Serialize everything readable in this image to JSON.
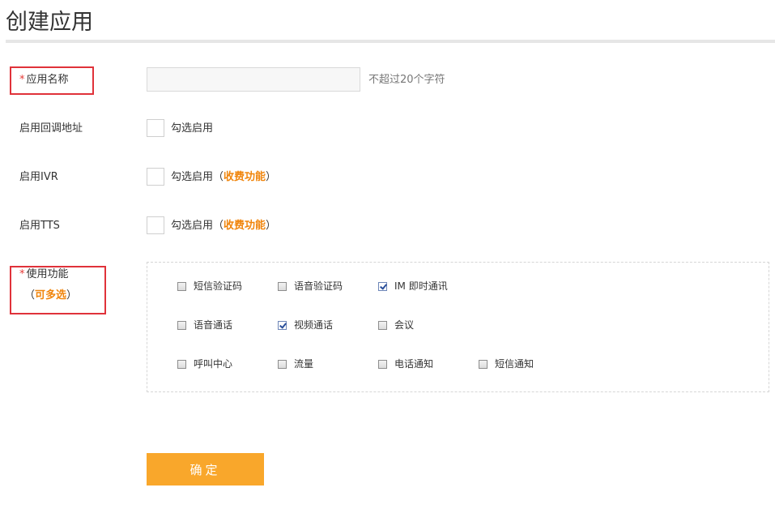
{
  "page": {
    "title": "创建应用"
  },
  "form": {
    "app_name": {
      "required_mark": "*",
      "label": "应用名称",
      "value": "",
      "placeholder": "",
      "hint": "不超过20个字符"
    },
    "callback": {
      "label": "启用回调地址",
      "checkbox_label": "勾选启用",
      "checked": false
    },
    "ivr": {
      "label": "启用IVR",
      "checkbox_label": "勾选启用（",
      "paid_text": "收费功能",
      "close": "）",
      "checked": false
    },
    "tts": {
      "label": "启用TTS",
      "checkbox_label": "勾选启用（",
      "paid_text": "收费功能",
      "close": "）",
      "checked": false
    },
    "features": {
      "required_mark": "*",
      "label": "使用功能",
      "sub_open": "（",
      "sub_text": "可多选",
      "sub_close": "）",
      "options": [
        {
          "label": "短信验证码",
          "checked": false
        },
        {
          "label": "语音验证码",
          "checked": false
        },
        {
          "label": "IM 即时通讯",
          "checked": true
        },
        {
          "label": "语音通话",
          "checked": false
        },
        {
          "label": "视频通话",
          "checked": true
        },
        {
          "label": "会议",
          "checked": false
        },
        {
          "label": "呼叫中心",
          "checked": false
        },
        {
          "label": "流量",
          "checked": false
        },
        {
          "label": "电话通知",
          "checked": false
        },
        {
          "label": "短信通知",
          "checked": false
        }
      ]
    },
    "submit_label": "确定"
  },
  "colors": {
    "accent": "#f9a72b",
    "paid": "#f0850c",
    "required": "#e53935",
    "highlight": "#e0323a"
  }
}
